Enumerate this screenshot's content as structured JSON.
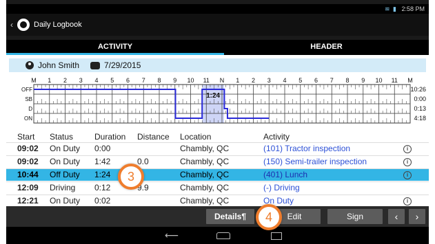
{
  "status_bar": {
    "time": "2:58 PM"
  },
  "app_bar": {
    "back_glyph": "‹",
    "title": "Daily Logbook"
  },
  "tabs": [
    {
      "label": "ACTIVITY",
      "active": true
    },
    {
      "label": "HEADER",
      "active": false
    }
  ],
  "driver": {
    "name": "John Smith",
    "date": "7/29/2015"
  },
  "log_graph": {
    "hour_labels": [
      "M",
      "1",
      "2",
      "3",
      "4",
      "5",
      "6",
      "7",
      "8",
      "9",
      "10",
      "11",
      "N",
      "1",
      "2",
      "3",
      "4",
      "5",
      "6",
      "7",
      "8",
      "9",
      "10",
      "11",
      "M"
    ],
    "status_labels": [
      "OFF",
      "SB",
      "D",
      "ON"
    ],
    "totals": [
      "10:26",
      "0:00",
      "0:13",
      "4:18"
    ],
    "highlight_label": "1:24",
    "segments": [
      {
        "status": "OFF",
        "start": 0,
        "end": 9.033
      },
      {
        "status": "ON",
        "start": 9.033,
        "end": 10.733
      },
      {
        "status": "OFF",
        "start": 10.733,
        "end": 12.15
      },
      {
        "status": "D",
        "start": 12.15,
        "end": 12.35
      },
      {
        "status": "ON",
        "start": 12.35,
        "end": 15.0
      }
    ],
    "highlight_range": [
      10.733,
      12.133
    ]
  },
  "table": {
    "headers": {
      "start": "Start",
      "status": "Status",
      "duration": "Duration",
      "distance": "Distance",
      "location": "Location",
      "activity": "Activity"
    },
    "rows": [
      {
        "start": "09:02",
        "status": "On Duty",
        "duration": "0:00",
        "distance": "",
        "location": "Chambly, QC",
        "activity": "(101) Tractor inspection",
        "info": true,
        "selected": false
      },
      {
        "start": "09:02",
        "status": "On Duty",
        "duration": "1:42",
        "distance": "0.0",
        "location": "Chambly, QC",
        "activity": "(150) Semi-trailer inspection",
        "info": true,
        "selected": false
      },
      {
        "start": "10:44",
        "status": "Off Duty",
        "duration": "1:24",
        "distance": "",
        "location": "Chambly, QC",
        "activity": "(401) Lunch",
        "info": true,
        "selected": true
      },
      {
        "start": "12:09",
        "status": "Driving",
        "duration": "0:12",
        "distance": "9.9",
        "location": "Chambly, QC",
        "activity": "(-) Driving",
        "info": false,
        "selected": false
      },
      {
        "start": "12:21",
        "status": "On Duty",
        "duration": "0:02",
        "distance": "",
        "location": "Chambly, QC",
        "activity": "On Duty",
        "info": true,
        "selected": false
      }
    ],
    "info_glyph": "i"
  },
  "toolbar": {
    "details": "Details¶",
    "edit": "Edit",
    "sign": "Sign",
    "prev": "‹",
    "next": "›"
  },
  "navbar": {
    "back": "⟵"
  },
  "callouts": {
    "three": "3",
    "four": "4"
  },
  "colors": {
    "accent": "#33b5e5",
    "graph_line": "#2a2ad8",
    "callout": "#ef7d2d"
  }
}
